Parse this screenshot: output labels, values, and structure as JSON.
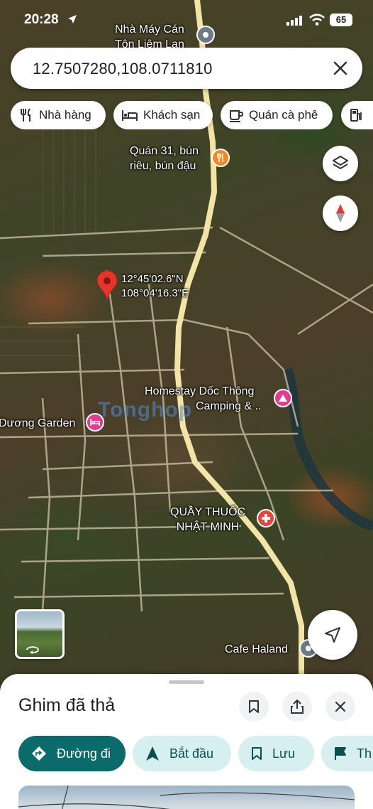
{
  "status_bar": {
    "time": "20:28",
    "battery": "65"
  },
  "search": {
    "query": "12.7507280,108.0711810"
  },
  "chips": [
    {
      "label": "Nhà hàng",
      "icon": "fork-knife-icon"
    },
    {
      "label": "Khách sạn",
      "icon": "bed-icon"
    },
    {
      "label": "Quán cà phê",
      "icon": "coffee-cup-icon"
    },
    {
      "label": "",
      "icon": "gas-station-icon"
    }
  ],
  "map": {
    "dropped_pin": {
      "lat": "12°45'02.6\"N",
      "lng": "108°04'16.3\"E"
    },
    "places": [
      {
        "name": "Nhà Máy Cán",
        "name2": "Tôn Liêm Lan",
        "icon": "place-pin-icon"
      },
      {
        "name": "Quán 31, bún",
        "name2": "riêu, bún đậu",
        "icon": "restaurant-icon"
      },
      {
        "name": "Homestay Dốc Thông",
        "name2": "Camping & ..",
        "icon": "camping-icon"
      },
      {
        "name": "Dương Garden",
        "icon": "hotel-icon"
      },
      {
        "name": "QUẦY THUỐC",
        "name2": "NHẬT MINH",
        "icon": "pharmacy-icon"
      },
      {
        "name": "Cafe Haland",
        "icon": "place-pin-icon"
      }
    ],
    "watermark": "Tonghop",
    "colors": {
      "road": "#f2e3a6",
      "pin": "#e3362d",
      "pharmacy": "#e5453f",
      "hotel": "#e23b8f",
      "restaurant": "#f08a24"
    }
  },
  "sheet": {
    "title": "Ghim đã thả",
    "actions": [
      {
        "label": "Đường đi",
        "icon": "directions-icon"
      },
      {
        "label": "Bắt đầu",
        "icon": "navigation-start-icon"
      },
      {
        "label": "Lưu",
        "icon": "bookmark-icon"
      },
      {
        "label": "Th",
        "icon": "flag-icon"
      }
    ],
    "accent": "#0b6b6a"
  }
}
